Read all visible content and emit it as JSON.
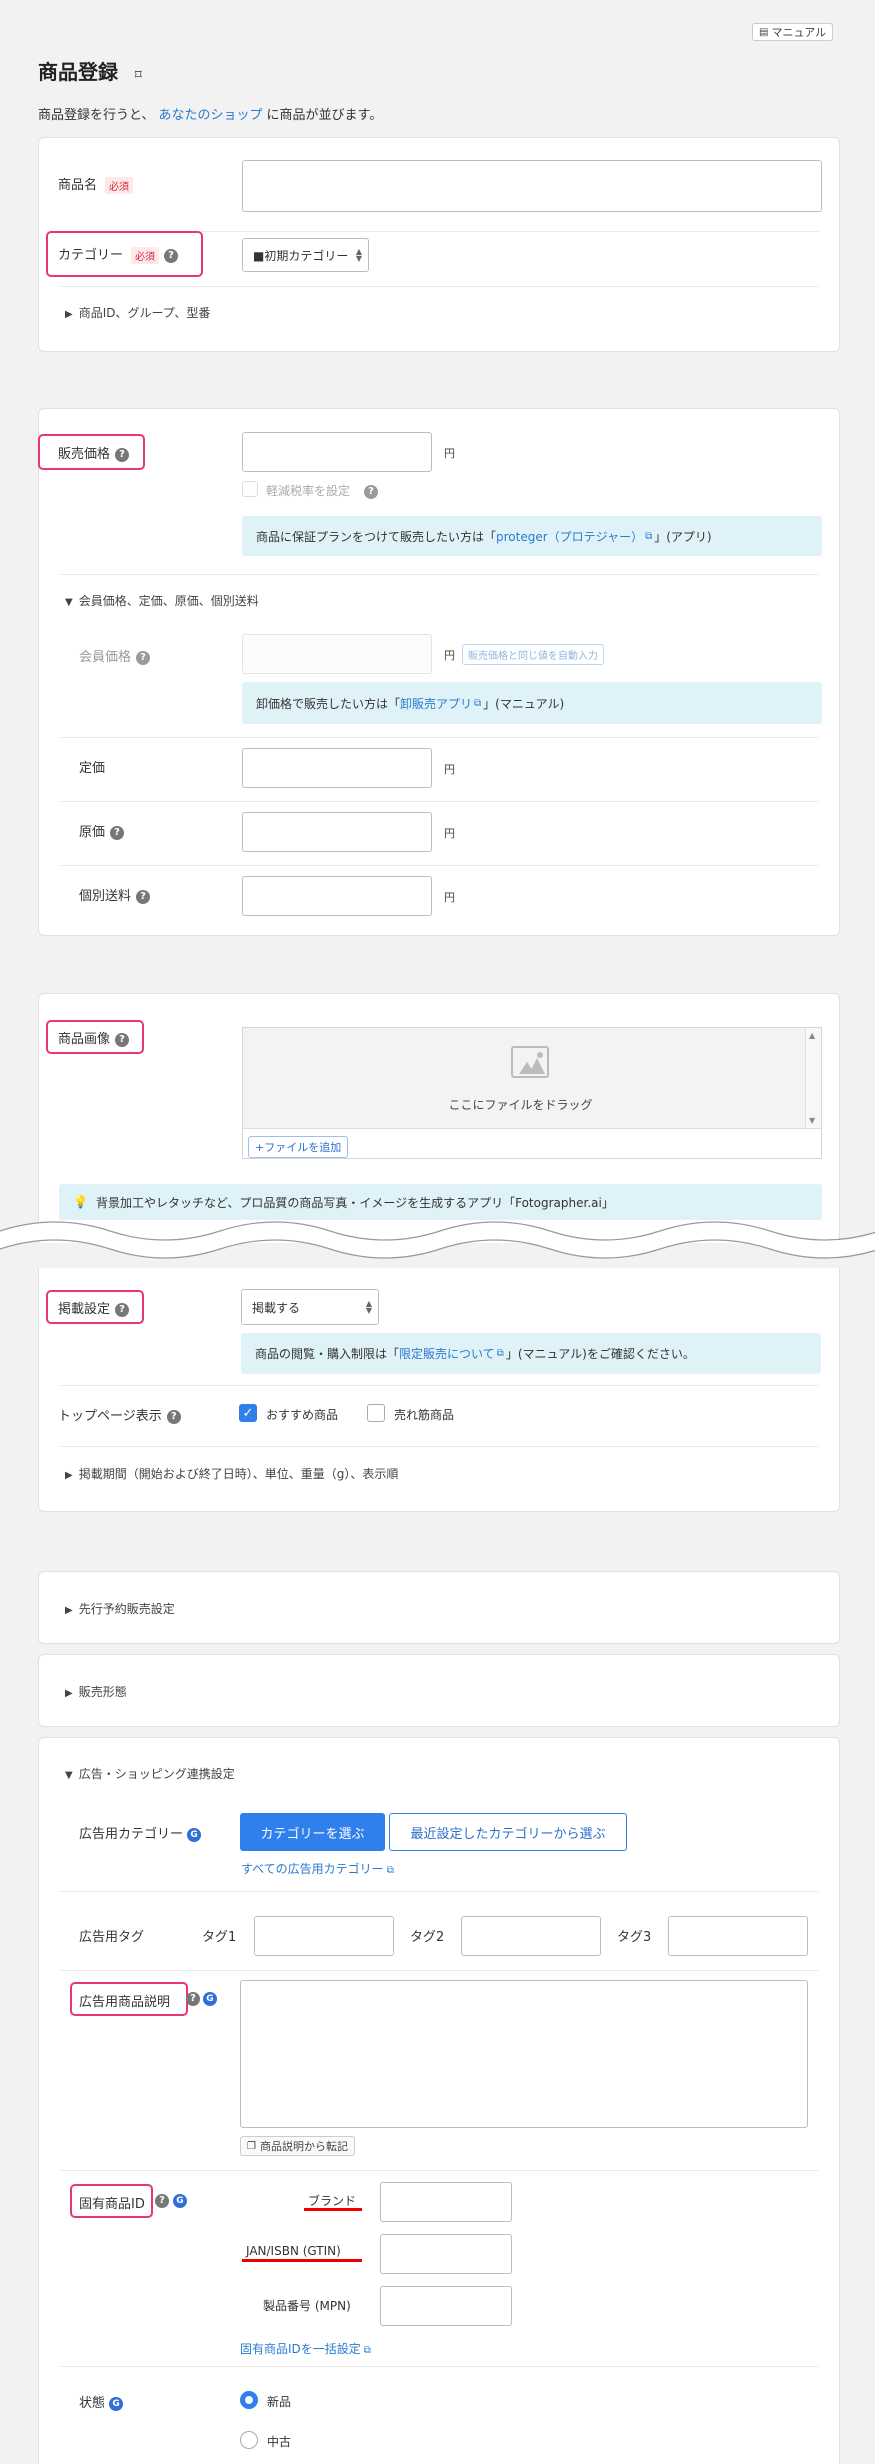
{
  "header": {
    "manual_button": "マニュアル",
    "page_title": "商品登録",
    "intro_before": "商品登録を行うと、",
    "intro_link": "あなたのショップ",
    "intro_after": "に商品が並びます。"
  },
  "basic": {
    "name_label": "商品名",
    "required": "必須",
    "category_label": "カテゴリー",
    "category_value": "■初期カテゴリー",
    "collapse_id": "商品ID、グループ、型番"
  },
  "price": {
    "sale_price_label": "販売価格",
    "yen": "円",
    "reduced_tax": "軽減税率を設定",
    "warranty_info_before": "商品に保証プランをつけて販売したい方は「",
    "warranty_link": "proteger（プロテジャー）",
    "warranty_info_after": "」(アプリ)",
    "member_section": "会員価格、定価、原価、個別送料",
    "member_price_label": "会員価格",
    "auto_input": "販売価格と同じ値を自動入力",
    "wholesale_before": "卸価格で販売したい方は「",
    "wholesale_link": "卸販売アプリ",
    "wholesale_after": "」(マニュアル)",
    "list_price_label": "定価",
    "cost_label": "原価",
    "shipping_label": "個別送料"
  },
  "image": {
    "label": "商品画像",
    "drop_text": "ここにファイルをドラッグ",
    "add_file": "+ファイルを追加",
    "fotographer_info": "背景加工やレタッチなど、プロ品質の商品写真・イメージを生成するアプリ「Fotographer.ai」"
  },
  "publish": {
    "label": "掲載設定",
    "value": "掲載する",
    "info_before": "商品の閲覧・購入制限は「",
    "info_link": "限定販売について",
    "info_after": "」(マニュアル)をご確認ください。",
    "top_label": "トップページ表示",
    "recommended": "おすすめ商品",
    "bestseller": "売れ筋商品",
    "collapse_period": "掲載期間（開始および終了日時）、単位、重量（g）、表示順"
  },
  "preorder": {
    "label": "先行予約販売設定"
  },
  "sales_form": {
    "label": "販売形態"
  },
  "ads": {
    "section": "広告・ショッピング連携設定",
    "category_label": "広告用カテゴリー",
    "choose_category": "カテゴリーを選ぶ",
    "recent_category": "最近設定したカテゴリーから選ぶ",
    "all_categories": "すべての広告用カテゴリー",
    "tag_label": "広告用タグ",
    "tag1": "タグ1",
    "tag2": "タグ2",
    "tag3": "タグ3",
    "desc_label": "広告用商品説明",
    "copy_desc": "商品説明から転記",
    "uid_label": "固有商品ID",
    "brand": "ブランド",
    "jan": "JAN/ISBN (GTIN)",
    "mpn": "製品番号 (MPN)",
    "bulk_link": "固有商品IDを一括設定",
    "condition_label": "状態",
    "new": "新品",
    "used": "中古"
  },
  "colors": {
    "accent": "#2f80ed",
    "highlight": "#e8386f",
    "info_bg": "#dff2f7"
  }
}
